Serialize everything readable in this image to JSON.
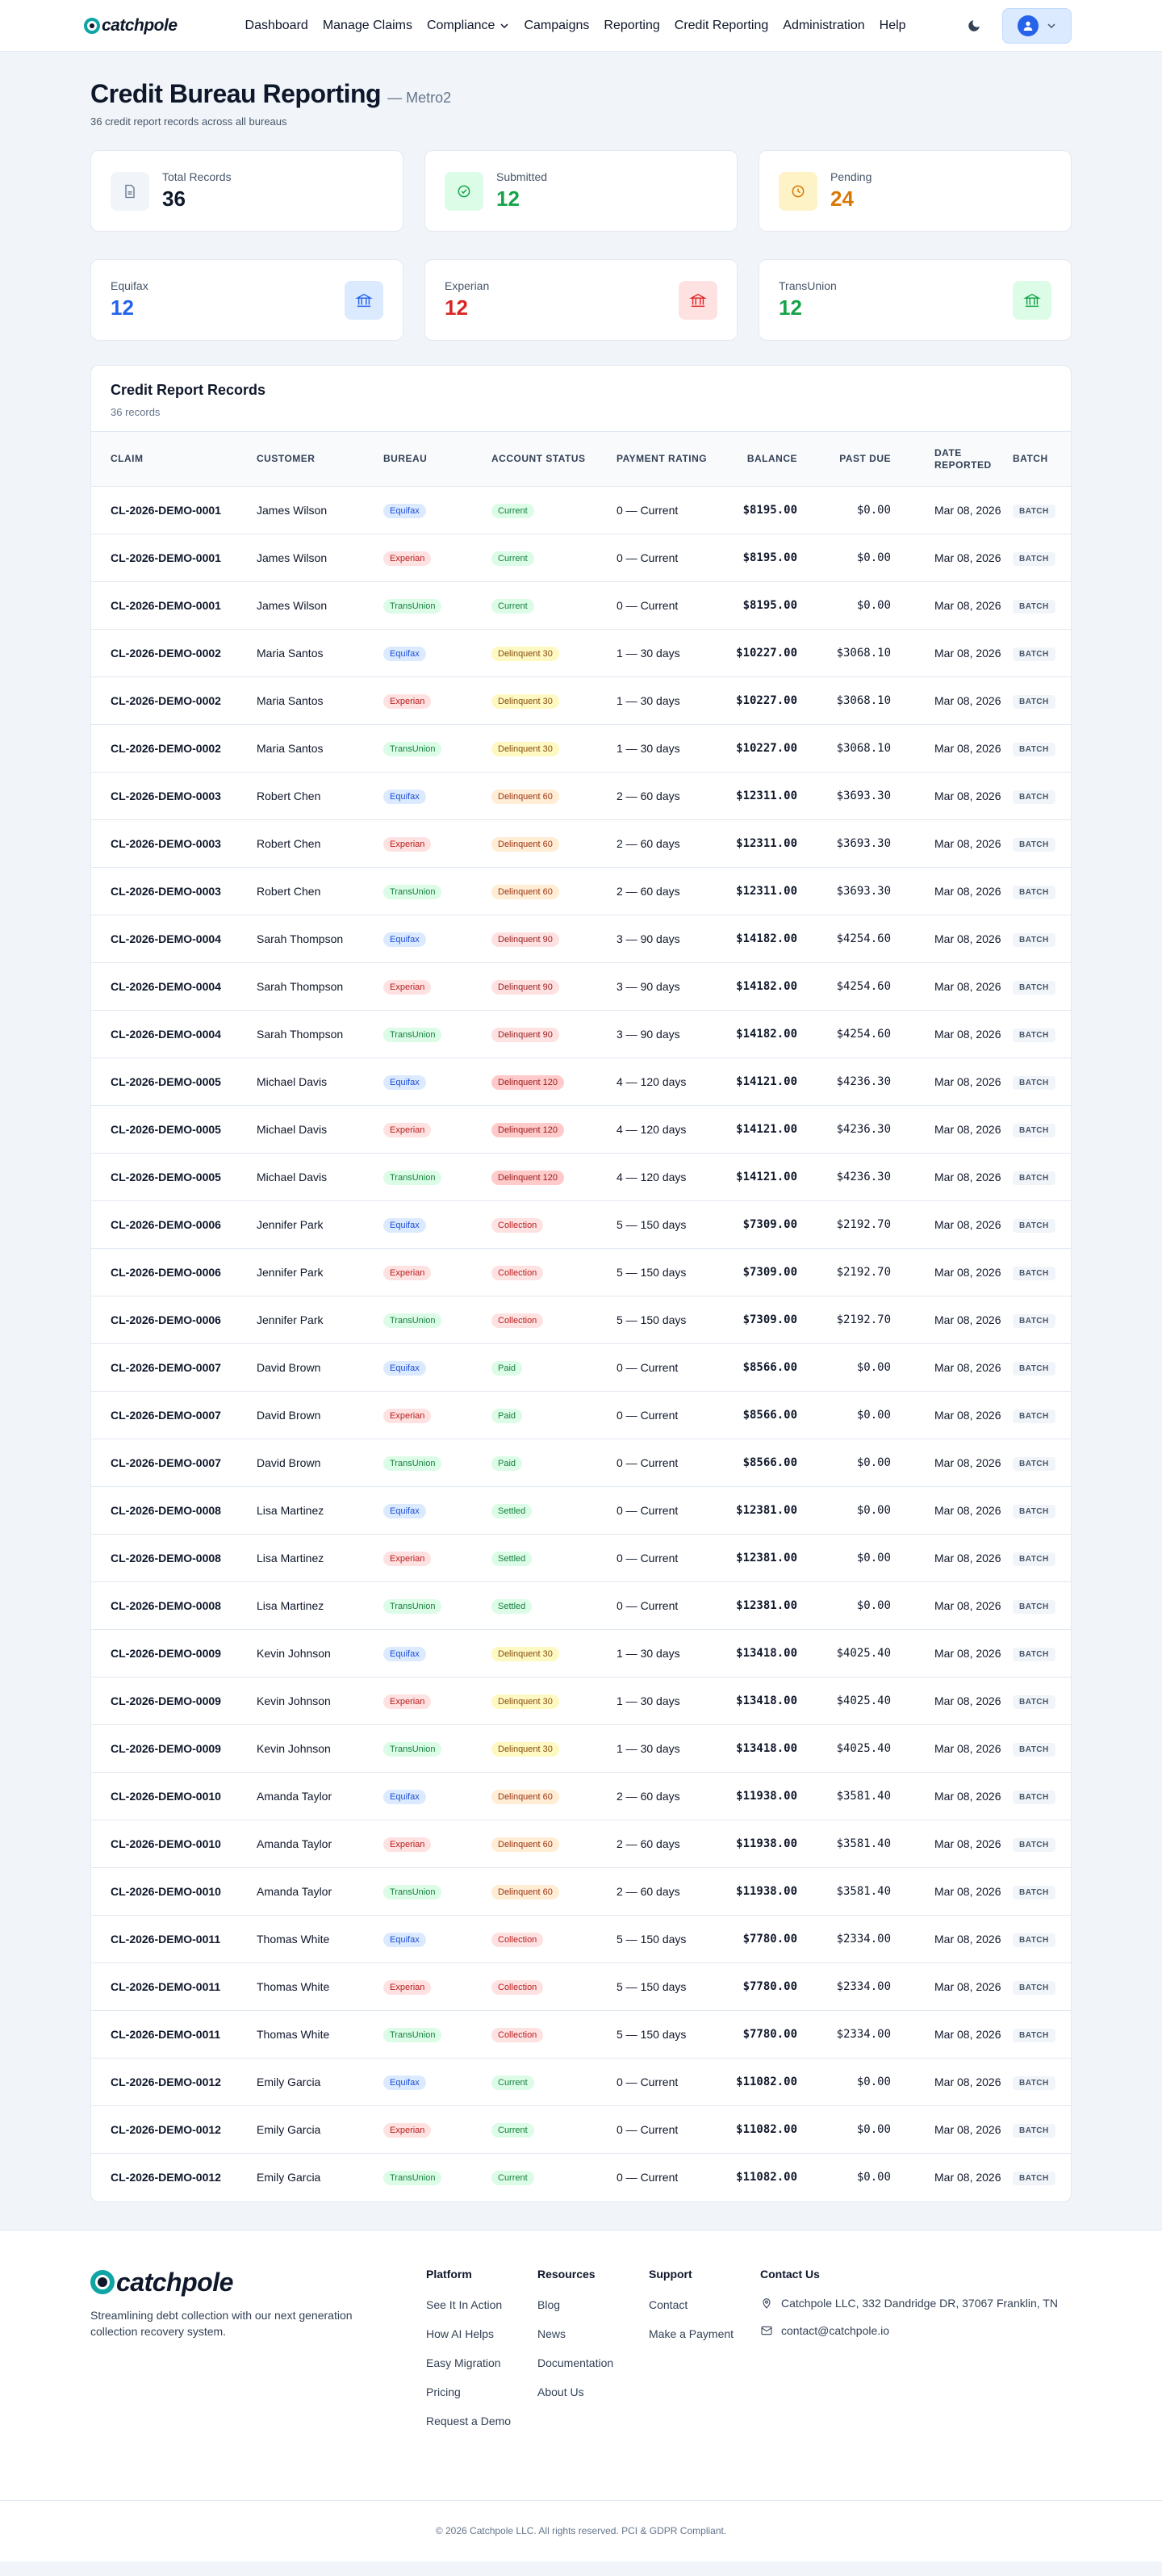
{
  "nav": {
    "brand": "catchpole",
    "links": [
      "Dashboard",
      "Manage Claims",
      "Compliance",
      "Campaigns",
      "Reporting",
      "Credit Reporting",
      "Administration",
      "Help"
    ]
  },
  "header": {
    "title": "Credit Bureau Reporting",
    "subtitle": "— Metro2",
    "description": "36 credit report records across all bureaus"
  },
  "stats": [
    {
      "label": "Total Records",
      "value": "36",
      "color": "#0f172a",
      "icon_bg": "#f1f5f9",
      "icon": "document-icon"
    },
    {
      "label": "Submitted",
      "value": "12",
      "color": "#16a34a",
      "icon_bg": "#dcfce7",
      "icon": "check-circle-icon"
    },
    {
      "label": "Pending",
      "value": "24",
      "color": "#d97706",
      "icon_bg": "#fef3c7",
      "icon": "clock-icon"
    }
  ],
  "bureaus": [
    {
      "label": "Equifax",
      "value": "12",
      "color": "#2563eb",
      "icon_bg": "#dbeafe",
      "icon": "bank-icon"
    },
    {
      "label": "Experian",
      "value": "12",
      "color": "#dc2626",
      "icon_bg": "#fee2e2",
      "icon": "bank-icon"
    },
    {
      "label": "TransUnion",
      "value": "12",
      "color": "#16a34a",
      "icon_bg": "#dcfce7",
      "icon": "bank-icon"
    }
  ],
  "records": {
    "title": "Credit Report Records",
    "count": "36 records",
    "columns": [
      "Claim",
      "Customer",
      "Bureau",
      "Account Status",
      "Payment Rating",
      "Balance",
      "Past Due",
      "Date Reported",
      "Batch"
    ],
    "bureau_colors": {
      "Equifax": {
        "bg": "#dbeafe",
        "fg": "#1d4ed8"
      },
      "Experian": {
        "bg": "#fee2e2",
        "fg": "#b91c1c"
      },
      "TransUnion": {
        "bg": "#dcfce7",
        "fg": "#15803d"
      }
    },
    "status_colors": {
      "Current": {
        "bg": "#dcfce7",
        "fg": "#15803d"
      },
      "Paid": {
        "bg": "#dcfce7",
        "fg": "#15803d"
      },
      "Settled": {
        "bg": "#dcfce7",
        "fg": "#15803d"
      },
      "Delinquent 30": {
        "bg": "#fef9c3",
        "fg": "#854d0e"
      },
      "Delinquent 60": {
        "bg": "#ffedd5",
        "fg": "#9a3412"
      },
      "Delinquent 90": {
        "bg": "#fee2e2",
        "fg": "#991b1b"
      },
      "Delinquent 120": {
        "bg": "#fecaca",
        "fg": "#991b1b"
      },
      "Collection": {
        "bg": "#fee2e2",
        "fg": "#b91c1c"
      }
    },
    "rows": [
      {
        "claim": "CL-2026-DEMO-0001",
        "customer": "James Wilson",
        "bureau": "Equifax",
        "status": "Current",
        "rating": "0 — Current",
        "balance": "$8195.00",
        "past_due": "$0.00",
        "date": "Mar 08, 2026",
        "batch": "BATCH"
      },
      {
        "claim": "CL-2026-DEMO-0001",
        "customer": "James Wilson",
        "bureau": "Experian",
        "status": "Current",
        "rating": "0 — Current",
        "balance": "$8195.00",
        "past_due": "$0.00",
        "date": "Mar 08, 2026",
        "batch": "BATCH"
      },
      {
        "claim": "CL-2026-DEMO-0001",
        "customer": "James Wilson",
        "bureau": "TransUnion",
        "status": "Current",
        "rating": "0 — Current",
        "balance": "$8195.00",
        "past_due": "$0.00",
        "date": "Mar 08, 2026",
        "batch": "BATCH"
      },
      {
        "claim": "CL-2026-DEMO-0002",
        "customer": "Maria Santos",
        "bureau": "Equifax",
        "status": "Delinquent 30",
        "rating": "1 — 30 days",
        "balance": "$10227.00",
        "past_due": "$3068.10",
        "date": "Mar 08, 2026",
        "batch": "BATCH"
      },
      {
        "claim": "CL-2026-DEMO-0002",
        "customer": "Maria Santos",
        "bureau": "Experian",
        "status": "Delinquent 30",
        "rating": "1 — 30 days",
        "balance": "$10227.00",
        "past_due": "$3068.10",
        "date": "Mar 08, 2026",
        "batch": "BATCH"
      },
      {
        "claim": "CL-2026-DEMO-0002",
        "customer": "Maria Santos",
        "bureau": "TransUnion",
        "status": "Delinquent 30",
        "rating": "1 — 30 days",
        "balance": "$10227.00",
        "past_due": "$3068.10",
        "date": "Mar 08, 2026",
        "batch": "BATCH"
      },
      {
        "claim": "CL-2026-DEMO-0003",
        "customer": "Robert Chen",
        "bureau": "Equifax",
        "status": "Delinquent 60",
        "rating": "2 — 60 days",
        "balance": "$12311.00",
        "past_due": "$3693.30",
        "date": "Mar 08, 2026",
        "batch": "BATCH"
      },
      {
        "claim": "CL-2026-DEMO-0003",
        "customer": "Robert Chen",
        "bureau": "Experian",
        "status": "Delinquent 60",
        "rating": "2 — 60 days",
        "balance": "$12311.00",
        "past_due": "$3693.30",
        "date": "Mar 08, 2026",
        "batch": "BATCH"
      },
      {
        "claim": "CL-2026-DEMO-0003",
        "customer": "Robert Chen",
        "bureau": "TransUnion",
        "status": "Delinquent 60",
        "rating": "2 — 60 days",
        "balance": "$12311.00",
        "past_due": "$3693.30",
        "date": "Mar 08, 2026",
        "batch": "BATCH"
      },
      {
        "claim": "CL-2026-DEMO-0004",
        "customer": "Sarah Thompson",
        "bureau": "Equifax",
        "status": "Delinquent 90",
        "rating": "3 — 90 days",
        "balance": "$14182.00",
        "past_due": "$4254.60",
        "date": "Mar 08, 2026",
        "batch": "BATCH"
      },
      {
        "claim": "CL-2026-DEMO-0004",
        "customer": "Sarah Thompson",
        "bureau": "Experian",
        "status": "Delinquent 90",
        "rating": "3 — 90 days",
        "balance": "$14182.00",
        "past_due": "$4254.60",
        "date": "Mar 08, 2026",
        "batch": "BATCH"
      },
      {
        "claim": "CL-2026-DEMO-0004",
        "customer": "Sarah Thompson",
        "bureau": "TransUnion",
        "status": "Delinquent 90",
        "rating": "3 — 90 days",
        "balance": "$14182.00",
        "past_due": "$4254.60",
        "date": "Mar 08, 2026",
        "batch": "BATCH"
      },
      {
        "claim": "CL-2026-DEMO-0005",
        "customer": "Michael Davis",
        "bureau": "Equifax",
        "status": "Delinquent 120",
        "rating": "4 — 120 days",
        "balance": "$14121.00",
        "past_due": "$4236.30",
        "date": "Mar 08, 2026",
        "batch": "BATCH"
      },
      {
        "claim": "CL-2026-DEMO-0005",
        "customer": "Michael Davis",
        "bureau": "Experian",
        "status": "Delinquent 120",
        "rating": "4 — 120 days",
        "balance": "$14121.00",
        "past_due": "$4236.30",
        "date": "Mar 08, 2026",
        "batch": "BATCH"
      },
      {
        "claim": "CL-2026-DEMO-0005",
        "customer": "Michael Davis",
        "bureau": "TransUnion",
        "status": "Delinquent 120",
        "rating": "4 — 120 days",
        "balance": "$14121.00",
        "past_due": "$4236.30",
        "date": "Mar 08, 2026",
        "batch": "BATCH"
      },
      {
        "claim": "CL-2026-DEMO-0006",
        "customer": "Jennifer Park",
        "bureau": "Equifax",
        "status": "Collection",
        "rating": "5 — 150 days",
        "balance": "$7309.00",
        "past_due": "$2192.70",
        "date": "Mar 08, 2026",
        "batch": "BATCH"
      },
      {
        "claim": "CL-2026-DEMO-0006",
        "customer": "Jennifer Park",
        "bureau": "Experian",
        "status": "Collection",
        "rating": "5 — 150 days",
        "balance": "$7309.00",
        "past_due": "$2192.70",
        "date": "Mar 08, 2026",
        "batch": "BATCH"
      },
      {
        "claim": "CL-2026-DEMO-0006",
        "customer": "Jennifer Park",
        "bureau": "TransUnion",
        "status": "Collection",
        "rating": "5 — 150 days",
        "balance": "$7309.00",
        "past_due": "$2192.70",
        "date": "Mar 08, 2026",
        "batch": "BATCH"
      },
      {
        "claim": "CL-2026-DEMO-0007",
        "customer": "David Brown",
        "bureau": "Equifax",
        "status": "Paid",
        "rating": "0 — Current",
        "balance": "$8566.00",
        "past_due": "$0.00",
        "date": "Mar 08, 2026",
        "batch": "BATCH"
      },
      {
        "claim": "CL-2026-DEMO-0007",
        "customer": "David Brown",
        "bureau": "Experian",
        "status": "Paid",
        "rating": "0 — Current",
        "balance": "$8566.00",
        "past_due": "$0.00",
        "date": "Mar 08, 2026",
        "batch": "BATCH"
      },
      {
        "claim": "CL-2026-DEMO-0007",
        "customer": "David Brown",
        "bureau": "TransUnion",
        "status": "Paid",
        "rating": "0 — Current",
        "balance": "$8566.00",
        "past_due": "$0.00",
        "date": "Mar 08, 2026",
        "batch": "BATCH"
      },
      {
        "claim": "CL-2026-DEMO-0008",
        "customer": "Lisa Martinez",
        "bureau": "Equifax",
        "status": "Settled",
        "rating": "0 — Current",
        "balance": "$12381.00",
        "past_due": "$0.00",
        "date": "Mar 08, 2026",
        "batch": "BATCH"
      },
      {
        "claim": "CL-2026-DEMO-0008",
        "customer": "Lisa Martinez",
        "bureau": "Experian",
        "status": "Settled",
        "rating": "0 — Current",
        "balance": "$12381.00",
        "past_due": "$0.00",
        "date": "Mar 08, 2026",
        "batch": "BATCH"
      },
      {
        "claim": "CL-2026-DEMO-0008",
        "customer": "Lisa Martinez",
        "bureau": "TransUnion",
        "status": "Settled",
        "rating": "0 — Current",
        "balance": "$12381.00",
        "past_due": "$0.00",
        "date": "Mar 08, 2026",
        "batch": "BATCH"
      },
      {
        "claim": "CL-2026-DEMO-0009",
        "customer": "Kevin Johnson",
        "bureau": "Equifax",
        "status": "Delinquent 30",
        "rating": "1 — 30 days",
        "balance": "$13418.00",
        "past_due": "$4025.40",
        "date": "Mar 08, 2026",
        "batch": "BATCH"
      },
      {
        "claim": "CL-2026-DEMO-0009",
        "customer": "Kevin Johnson",
        "bureau": "Experian",
        "status": "Delinquent 30",
        "rating": "1 — 30 days",
        "balance": "$13418.00",
        "past_due": "$4025.40",
        "date": "Mar 08, 2026",
        "batch": "BATCH"
      },
      {
        "claim": "CL-2026-DEMO-0009",
        "customer": "Kevin Johnson",
        "bureau": "TransUnion",
        "status": "Delinquent 30",
        "rating": "1 — 30 days",
        "balance": "$13418.00",
        "past_due": "$4025.40",
        "date": "Mar 08, 2026",
        "batch": "BATCH"
      },
      {
        "claim": "CL-2026-DEMO-0010",
        "customer": "Amanda Taylor",
        "bureau": "Equifax",
        "status": "Delinquent 60",
        "rating": "2 — 60 days",
        "balance": "$11938.00",
        "past_due": "$3581.40",
        "date": "Mar 08, 2026",
        "batch": "BATCH"
      },
      {
        "claim": "CL-2026-DEMO-0010",
        "customer": "Amanda Taylor",
        "bureau": "Experian",
        "status": "Delinquent 60",
        "rating": "2 — 60 days",
        "balance": "$11938.00",
        "past_due": "$3581.40",
        "date": "Mar 08, 2026",
        "batch": "BATCH"
      },
      {
        "claim": "CL-2026-DEMO-0010",
        "customer": "Amanda Taylor",
        "bureau": "TransUnion",
        "status": "Delinquent 60",
        "rating": "2 — 60 days",
        "balance": "$11938.00",
        "past_due": "$3581.40",
        "date": "Mar 08, 2026",
        "batch": "BATCH"
      },
      {
        "claim": "CL-2026-DEMO-0011",
        "customer": "Thomas White",
        "bureau": "Equifax",
        "status": "Collection",
        "rating": "5 — 150 days",
        "balance": "$7780.00",
        "past_due": "$2334.00",
        "date": "Mar 08, 2026",
        "batch": "BATCH"
      },
      {
        "claim": "CL-2026-DEMO-0011",
        "customer": "Thomas White",
        "bureau": "Experian",
        "status": "Collection",
        "rating": "5 — 150 days",
        "balance": "$7780.00",
        "past_due": "$2334.00",
        "date": "Mar 08, 2026",
        "batch": "BATCH"
      },
      {
        "claim": "CL-2026-DEMO-0011",
        "customer": "Thomas White",
        "bureau": "TransUnion",
        "status": "Collection",
        "rating": "5 — 150 days",
        "balance": "$7780.00",
        "past_due": "$2334.00",
        "date": "Mar 08, 2026",
        "batch": "BATCH"
      },
      {
        "claim": "CL-2026-DEMO-0012",
        "customer": "Emily Garcia",
        "bureau": "Equifax",
        "status": "Current",
        "rating": "0 — Current",
        "balance": "$11082.00",
        "past_due": "$0.00",
        "date": "Mar 08, 2026",
        "batch": "BATCH"
      },
      {
        "claim": "CL-2026-DEMO-0012",
        "customer": "Emily Garcia",
        "bureau": "Experian",
        "status": "Current",
        "rating": "0 — Current",
        "balance": "$11082.00",
        "past_due": "$0.00",
        "date": "Mar 08, 2026",
        "batch": "BATCH"
      },
      {
        "claim": "CL-2026-DEMO-0012",
        "customer": "Emily Garcia",
        "bureau": "TransUnion",
        "status": "Current",
        "rating": "0 — Current",
        "balance": "$11082.00",
        "past_due": "$0.00",
        "date": "Mar 08, 2026",
        "batch": "BATCH"
      }
    ]
  },
  "footer": {
    "brand": "catchpole",
    "tagline": "Streamlining debt collection with our next generation collection recovery system.",
    "columns": [
      {
        "title": "Platform",
        "links": [
          "See It In Action",
          "How AI Helps",
          "Easy Migration",
          "Pricing",
          "Request a Demo"
        ]
      },
      {
        "title": "Resources",
        "links": [
          "Blog",
          "News",
          "Documentation",
          "About Us"
        ]
      },
      {
        "title": "Support",
        "links": [
          "Contact",
          "Make a Payment"
        ]
      }
    ],
    "contact": {
      "title": "Contact Us",
      "address": "Catchpole LLC, 332 Dandridge DR, 37067 Franklin, TN",
      "email": "contact@catchpole.io"
    },
    "copyright": "© 2026 Catchpole LLC. All rights reserved. PCI & GDPR Compliant."
  }
}
